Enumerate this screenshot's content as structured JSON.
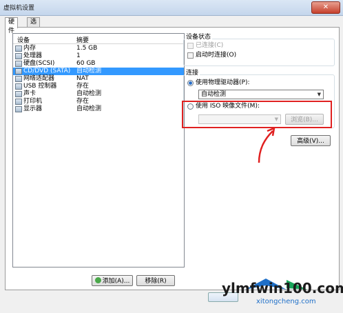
{
  "window": {
    "title": "虚拟机设置",
    "close_label": "✕"
  },
  "tabs": [
    {
      "label": "硬件",
      "active": true
    },
    {
      "label": "选项",
      "active": false
    }
  ],
  "devices": {
    "headers": {
      "device": "设备",
      "summary": "摘要"
    },
    "rows": [
      {
        "name": "内存",
        "summary": "1.5 GB",
        "icon": "memory-icon",
        "selected": false
      },
      {
        "name": "处理器",
        "summary": "1",
        "icon": "processor-icon",
        "selected": false
      },
      {
        "name": "硬盘(SCSI)",
        "summary": "60 GB",
        "icon": "hard-disk-icon",
        "selected": false
      },
      {
        "name": "CD/DVD (SATA)",
        "summary": "自动检测",
        "icon": "cd-dvd-icon",
        "selected": true
      },
      {
        "name": "网络适配器",
        "summary": "NAT",
        "icon": "network-adapter-icon",
        "selected": false
      },
      {
        "name": "USB 控制器",
        "summary": "存在",
        "icon": "usb-controller-icon",
        "selected": false
      },
      {
        "name": "声卡",
        "summary": "自动检测",
        "icon": "sound-card-icon",
        "selected": false
      },
      {
        "name": "打印机",
        "summary": "存在",
        "icon": "printer-icon",
        "selected": false
      },
      {
        "name": "显示器",
        "summary": "自动检测",
        "icon": "display-icon",
        "selected": false
      }
    ],
    "add_label": "添加(A)...",
    "remove_label": "移除(R)"
  },
  "device_status": {
    "title": "设备状态",
    "connected_label": "已连接(C)",
    "connect_on_power_label": "启动时连接(O)"
  },
  "connection": {
    "title": "连接",
    "physical_label": "使用物理驱动器(P):",
    "physical_value": "自动检测",
    "iso_label": "使用 ISO 映像文件(M):",
    "iso_value": "",
    "browse_label": "浏览(B)...",
    "advanced_label": "高级(V)..."
  },
  "colors": {
    "highlight": "#e02020",
    "selection": "#3399ff"
  },
  "watermark": {
    "main": "ylmfwin100.com",
    "sub": "xitongcheng.com"
  }
}
